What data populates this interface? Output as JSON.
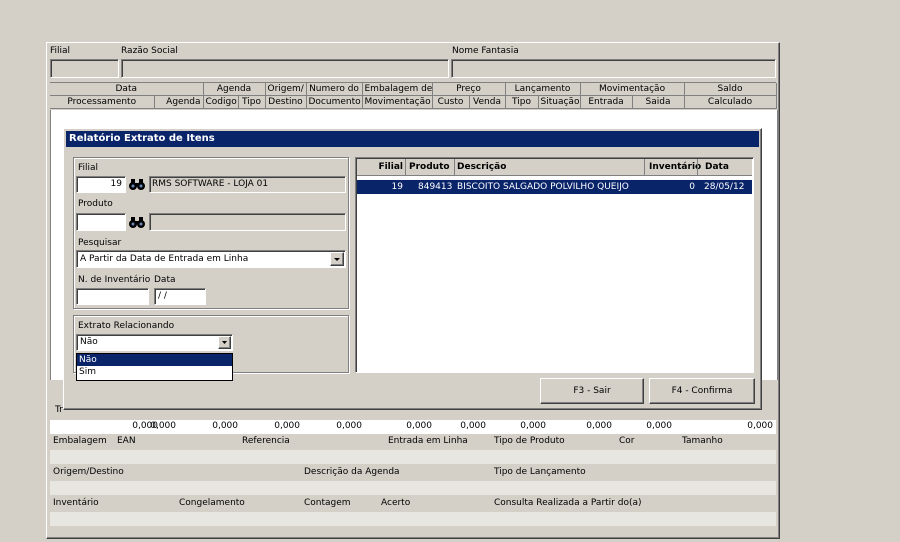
{
  "header": {
    "filial_label": "Filial",
    "razao_label": "Razão Social",
    "nome_fantasia_label": "Nome Fantasia"
  },
  "grid": {
    "group_headers": [
      "Data",
      "Agenda",
      "Origem/",
      "Numero do",
      "Embalagem de",
      "Preço",
      "Lançamento",
      "Movimentação",
      "Saldo"
    ],
    "sub_headers": [
      "Processamento",
      "Agenda",
      "Codigo",
      "Tipo",
      "Destino",
      "Documento",
      "Movimentação",
      "Custo",
      "Venda",
      "Tipo",
      "Situação",
      "Entrada",
      "Saida",
      "Calculado"
    ]
  },
  "bottom": {
    "tr_label": "Tr",
    "totals": [
      "0,000",
      "0,000",
      "0,000",
      "0,000",
      "0,000",
      "0,000",
      "0,000",
      "0,000",
      "0,000",
      "0,000",
      "0,000"
    ],
    "row1_labels": [
      "Embalagem",
      "EAN",
      "Referencia",
      "Entrada em Linha",
      "Tipo de Produto",
      "Cor",
      "Tamanho"
    ],
    "row2_labels": [
      "Origem/Destino",
      "Descrição da Agenda",
      "Tipo de Lançamento"
    ],
    "row3_labels": [
      "Inventário",
      "Congelamento",
      "Contagem",
      "Acerto",
      "Consulta Realizada a Partir do(a)"
    ]
  },
  "dialog": {
    "title": "Relatório Extrato de Itens",
    "filial_label": "Filial",
    "filial_value": "19",
    "filial_name": "RMS SOFTWARE - LOJA 01",
    "produto_label": "Produto",
    "produto_value": "",
    "produto_name": "",
    "pesquisar_label": "Pesquisar",
    "pesquisar_value": "A Partir da Data de Entrada em Linha",
    "inventario_label": "N. de Inventário",
    "data_label": "Data",
    "inventario_value": "",
    "data_value": " / /",
    "extrato_label": "Extrato Relacionando",
    "extrato_value": "Não",
    "extrato_options": [
      "Não",
      "Sim"
    ],
    "list_headers": [
      "Filial",
      "Produto",
      "Descrição",
      "Inventário",
      "Data"
    ],
    "list_rows": [
      {
        "filial": "19",
        "produto": "849413",
        "descricao": "BISCOITO SALGADO POLVILHO QUEIJO",
        "inventario": "0",
        "data": "28/05/12"
      }
    ],
    "btn_sair": "F3 - Sair",
    "btn_confirma": "F4 - Confirma"
  }
}
